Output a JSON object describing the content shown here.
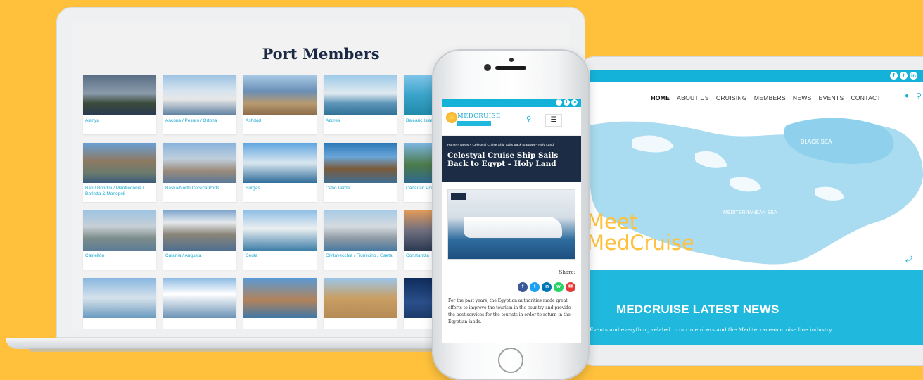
{
  "laptop": {
    "title": "Port Members",
    "ports": [
      "Alanya",
      "Ancona / Pesaro / Ortona",
      "Ashdod",
      "Azores",
      "Balearic Island",
      "Bari / Brindisi / Manfredonia / Barletta & Monopoli",
      "Bastia/North Corsica Ports",
      "Burgas",
      "Cabo Verde",
      "Canarian Port",
      "Castellón",
      "Catania / Augusta",
      "Ceuta",
      "Civitavecchia / Fiumicino / Gaeta",
      "Constantza",
      "",
      "",
      "",
      "",
      ""
    ]
  },
  "phone": {
    "logo": "MEDCRUISE",
    "breadcrumb": "Home » News » Celestyal Cruise Ship Sails Back to Egypt – Holy Land",
    "title": "Celestyal Cruise Ship Sails Back to Egypt – Holy Land",
    "share_label": "Share:",
    "body": "For the past years, the Egyptian authorities made great efforts to improve the tourism in the country and provide the best services for the tourists in order to return in the Egyptian lands.",
    "share_buttons": [
      {
        "icon": "facebook-icon",
        "glyph": "f",
        "color": "#3b5998"
      },
      {
        "icon": "twitter-icon",
        "glyph": "t",
        "color": "#1da1f2"
      },
      {
        "icon": "linkedin-icon",
        "glyph": "in",
        "color": "#0077b5"
      },
      {
        "icon": "whatsapp-icon",
        "glyph": "w",
        "color": "#25d366"
      },
      {
        "icon": "email-icon",
        "glyph": "✉",
        "color": "#e53935"
      }
    ]
  },
  "tablet": {
    "nav": [
      "HOME",
      "ABOUT US",
      "CRUISING",
      "MEMBERS",
      "NEWS",
      "EVENTS",
      "CONTACT"
    ],
    "map_labels": {
      "black_sea": "BLACK SEA",
      "med_sea": "MEDITERRANEAN SEA"
    },
    "meet_line1": "Meet",
    "meet_line2": "MedCruise",
    "news_title": "MEDCRUISE LATEST NEWS",
    "news_sub": "Events and everything related to our members and the Mediterranean cruise line industry"
  },
  "social": [
    {
      "icon": "facebook-icon",
      "glyph": "f"
    },
    {
      "icon": "twitter-icon",
      "glyph": "t"
    },
    {
      "icon": "linkedin-icon",
      "glyph": "in"
    }
  ],
  "colors": {
    "background": "#FFC13C",
    "accent": "#14B2D8",
    "navy": "#1B2C44"
  }
}
